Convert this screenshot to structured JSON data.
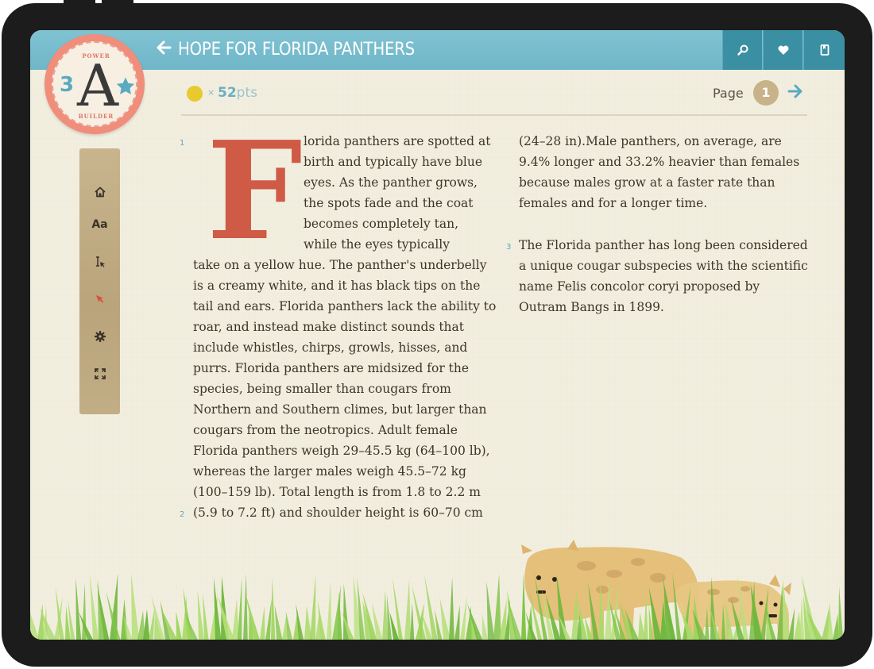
{
  "header": {
    "back_icon": "arrow-left-icon",
    "title": "HOPE FOR FLORIDA PANTHERS",
    "buttons": [
      {
        "icon": "search-icon"
      },
      {
        "icon": "heart-icon"
      },
      {
        "icon": "bookmark-icon"
      }
    ]
  },
  "badge": {
    "top_text": "POWER",
    "bottom_text": "BUILDER",
    "level": "3",
    "letter": "A",
    "icon": "star-icon"
  },
  "toolbar": {
    "items": [
      {
        "name": "home",
        "icon": "home-icon"
      },
      {
        "name": "font",
        "label": "Aa"
      },
      {
        "name": "text-select",
        "icon": "text-cursor-icon"
      },
      {
        "name": "pointer",
        "icon": "arrow-pointer-icon"
      },
      {
        "name": "settings",
        "icon": "gear-icon"
      },
      {
        "name": "fullscreen",
        "icon": "expand-icon"
      }
    ]
  },
  "status": {
    "coin_icon": "coin-icon",
    "multiplier": "×",
    "points_value": "52",
    "points_unit": "pts",
    "page_label": "Page",
    "page_number": "1",
    "next_icon": "arrow-right-icon"
  },
  "article": {
    "drop_cap": "F",
    "p1_number": "1",
    "p1_indented_lines": [
      "lorida panthers are spotted at",
      "birth and typically have blue",
      "eyes. As the panther grows,",
      "the spots fade and the coat",
      "becomes completely tan,",
      "while the eyes typically"
    ],
    "p1_full_lines": [
      "take on a yellow hue. The panther's underbelly",
      "is a creamy white, and it has black tips on the",
      "tail and ears. Florida panthers lack the ability to",
      "roar, and instead make distinct sounds that",
      "include whistles, chirps, growls, hisses, and",
      "purrs. Florida panthers are midsized for the",
      "species, being smaller than cougars from",
      "Northern and Southern climes, but larger than",
      "cougars from the neotropics. Adult female",
      "Florida panthers weigh 29–45.5 kg (64–100 lb),",
      "whereas the larger males weigh 45.5–72 kg",
      "(100–159 lb). Total length is from 1.8 to 2.2 m"
    ],
    "p2_number": "2",
    "p2_lines": [
      "(5.9 to 7.2 ft) and shoulder height is 60–70 cm",
      "(24–28 in).Male panthers, on average, are",
      "9.4% longer and 33.2% heavier than females",
      "because males grow at a faster rate than",
      "females and for a longer time."
    ],
    "p3_number": "3",
    "p3_lines": [
      "The Florida panther has long been considered",
      "a unique cougar subspecies with the scientific",
      "name Felis concolor coryi proposed by",
      "Outram Bangs in 1899."
    ]
  },
  "colors": {
    "header": "#6fb6c8",
    "header_button": "#3b8fa2",
    "accent_blue": "#5aaac0",
    "drop_cap": "#cf5a45",
    "paper": "#f3efdf",
    "toolbar": "#c2ae86",
    "panther": "#e4c07a",
    "grass": "#8fcf4f"
  }
}
